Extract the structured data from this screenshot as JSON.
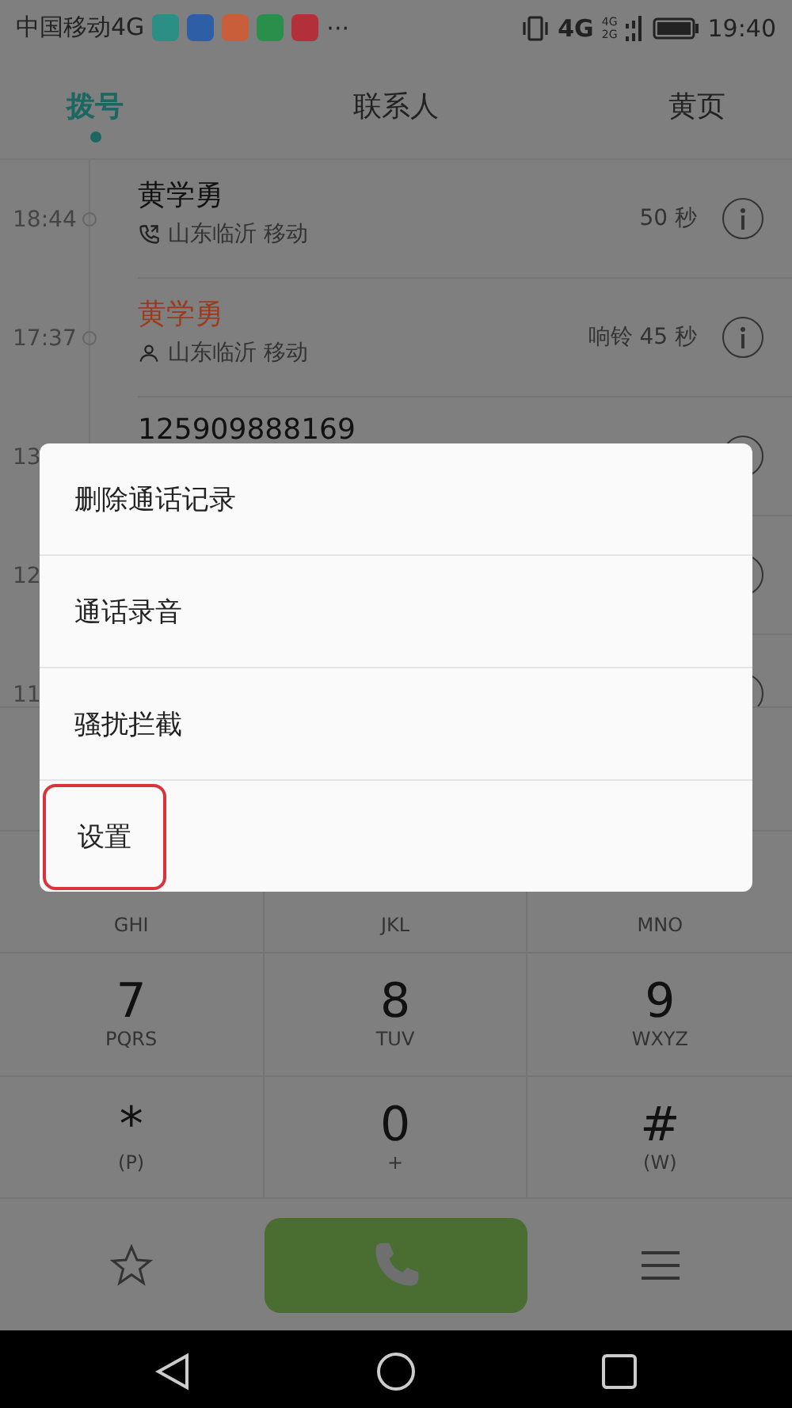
{
  "status_bar": {
    "carrier": "中国移动4G",
    "more": "···",
    "network": "4G",
    "signal_labels": [
      "4G",
      "2G"
    ],
    "time": "19:40"
  },
  "tabs": [
    {
      "label": "拨号",
      "selected": true
    },
    {
      "label": "联系人",
      "selected": false
    },
    {
      "label": "黄页",
      "selected": false
    }
  ],
  "call_log": [
    {
      "time": "18:44",
      "name": "黄学勇",
      "missed": false,
      "kind": "call",
      "location": "山东临沂 移动",
      "duration": "50 秒"
    },
    {
      "time": "17:37",
      "name": "黄学勇",
      "missed": true,
      "kind": "contact",
      "location": "山东临沂 移动",
      "duration": "响铃 45 秒"
    },
    {
      "time": "13",
      "name": "125909888169",
      "missed": false
    },
    {
      "time": "12"
    },
    {
      "time": "11"
    }
  ],
  "menu": [
    {
      "label": "删除通话记录",
      "highlighted": false
    },
    {
      "label": "通话录音",
      "highlighted": false
    },
    {
      "label": "骚扰拦截",
      "highlighted": false
    },
    {
      "label": "设置",
      "highlighted": true
    }
  ],
  "keypad": [
    [
      {
        "letters": "GHI"
      },
      {
        "letters": "JKL"
      },
      {
        "letters": "MNO"
      }
    ],
    [
      {
        "digit": "7",
        "letters": "PQRS"
      },
      {
        "digit": "8",
        "letters": "TUV"
      },
      {
        "digit": "9",
        "letters": "WXYZ"
      }
    ],
    [
      {
        "digit": "*",
        "letters": "(P)"
      },
      {
        "digit": "0",
        "letters": "+"
      },
      {
        "digit": "#",
        "letters": "(W)"
      }
    ]
  ]
}
